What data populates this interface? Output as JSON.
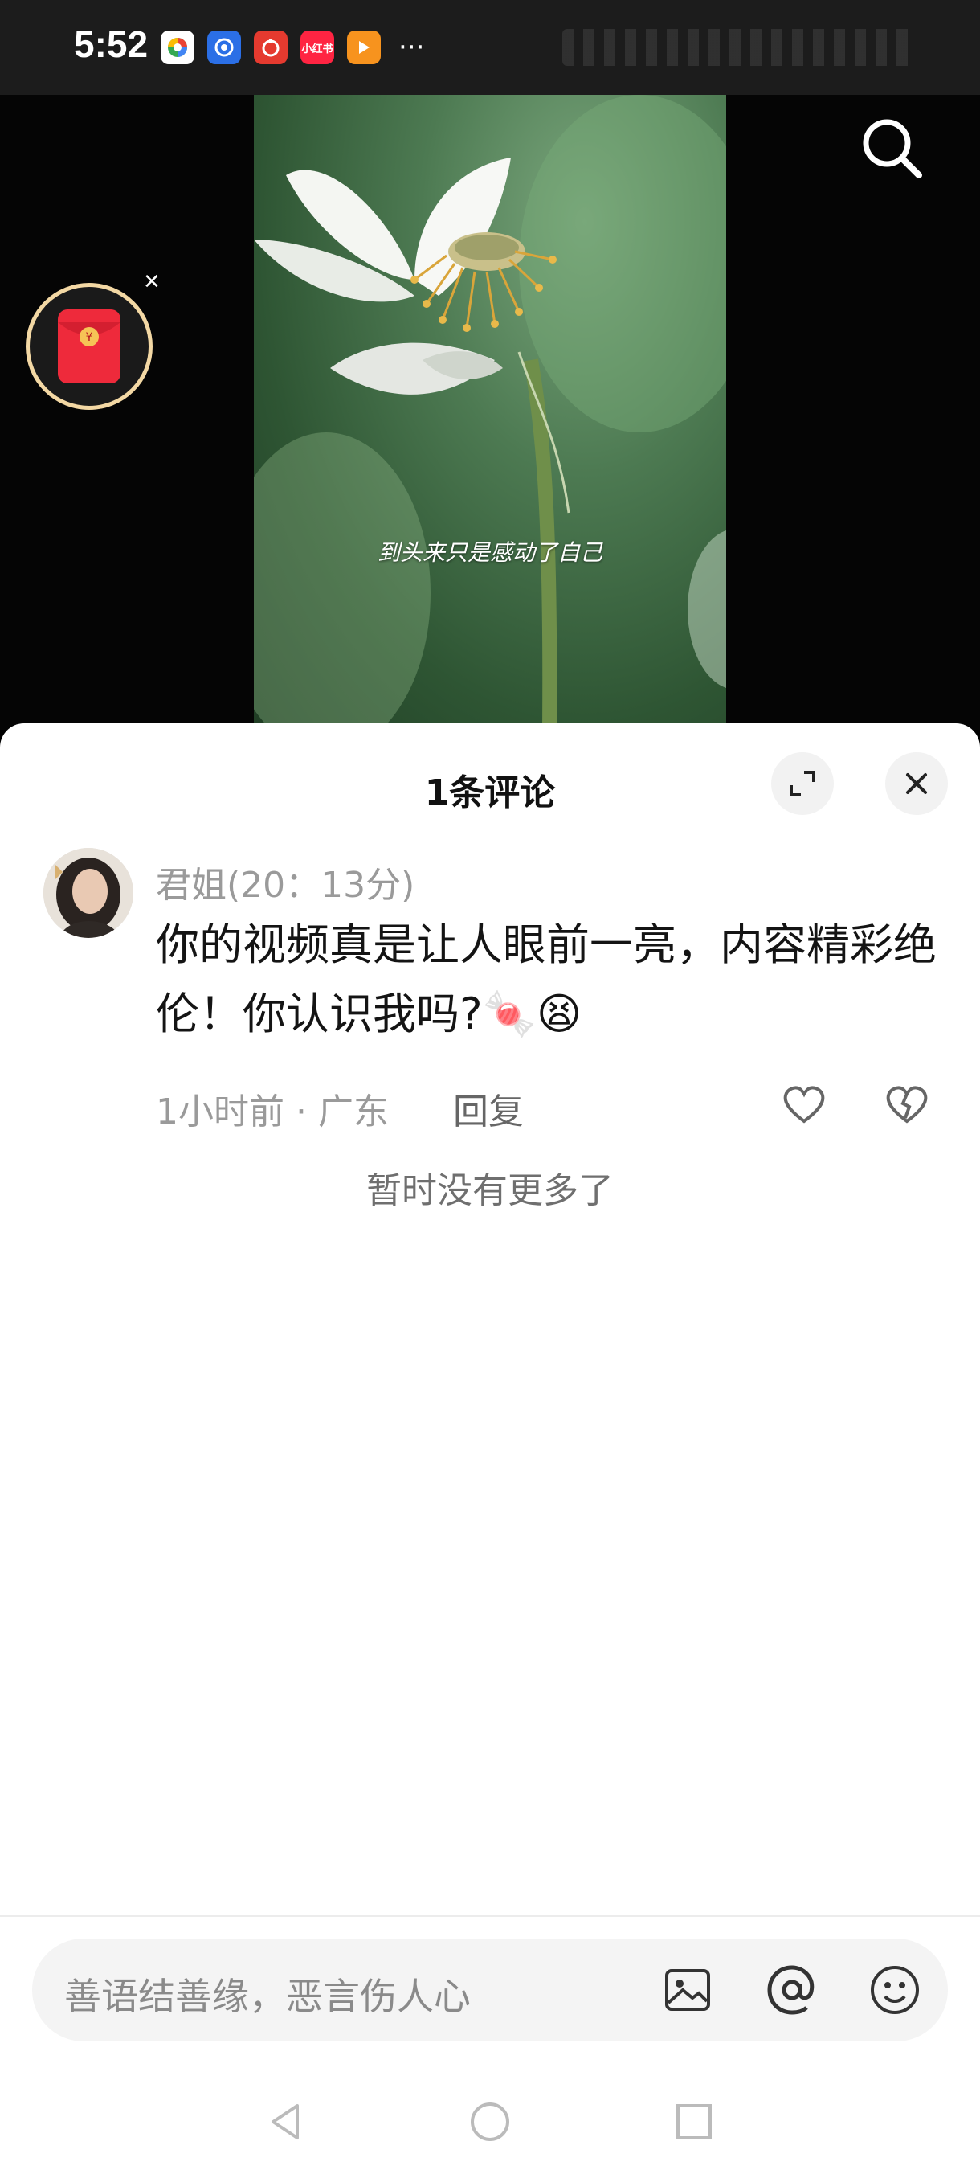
{
  "status_bar": {
    "time": "5:52",
    "app_icons": [
      {
        "name": "colorful-app-icon",
        "color": "#ffffff",
        "label": ""
      },
      {
        "name": "blue-app-icon",
        "color": "#2b6fe6",
        "label": ""
      },
      {
        "name": "red-app-icon",
        "color": "#e53a2f",
        "label": ""
      },
      {
        "name": "xiaohongshu-icon",
        "color": "#ff2442",
        "label": "小红书"
      },
      {
        "name": "orange-play-icon",
        "color": "#f7931e",
        "label": ""
      }
    ],
    "more": "···"
  },
  "video": {
    "caption": "到头来只是感动了自己"
  },
  "comments_sheet": {
    "title": "1条评论",
    "comments": [
      {
        "author": "君姐(20：13分)",
        "text": "你的视频真是让人眼前一亮，内容精彩绝伦！你认识我吗?🍬😫",
        "meta": "1小时前 · 广东",
        "reply_label": "回复"
      }
    ],
    "no_more_text": "暂时没有更多了",
    "input": {
      "placeholder": "善语结善缘，恶言伤人心"
    }
  },
  "colors": {
    "accent_red": "#ee2a3b",
    "gold_ring": "#f3d8a4",
    "sheet_bg": "#ffffff",
    "muted_text": "#9a9a9a"
  }
}
